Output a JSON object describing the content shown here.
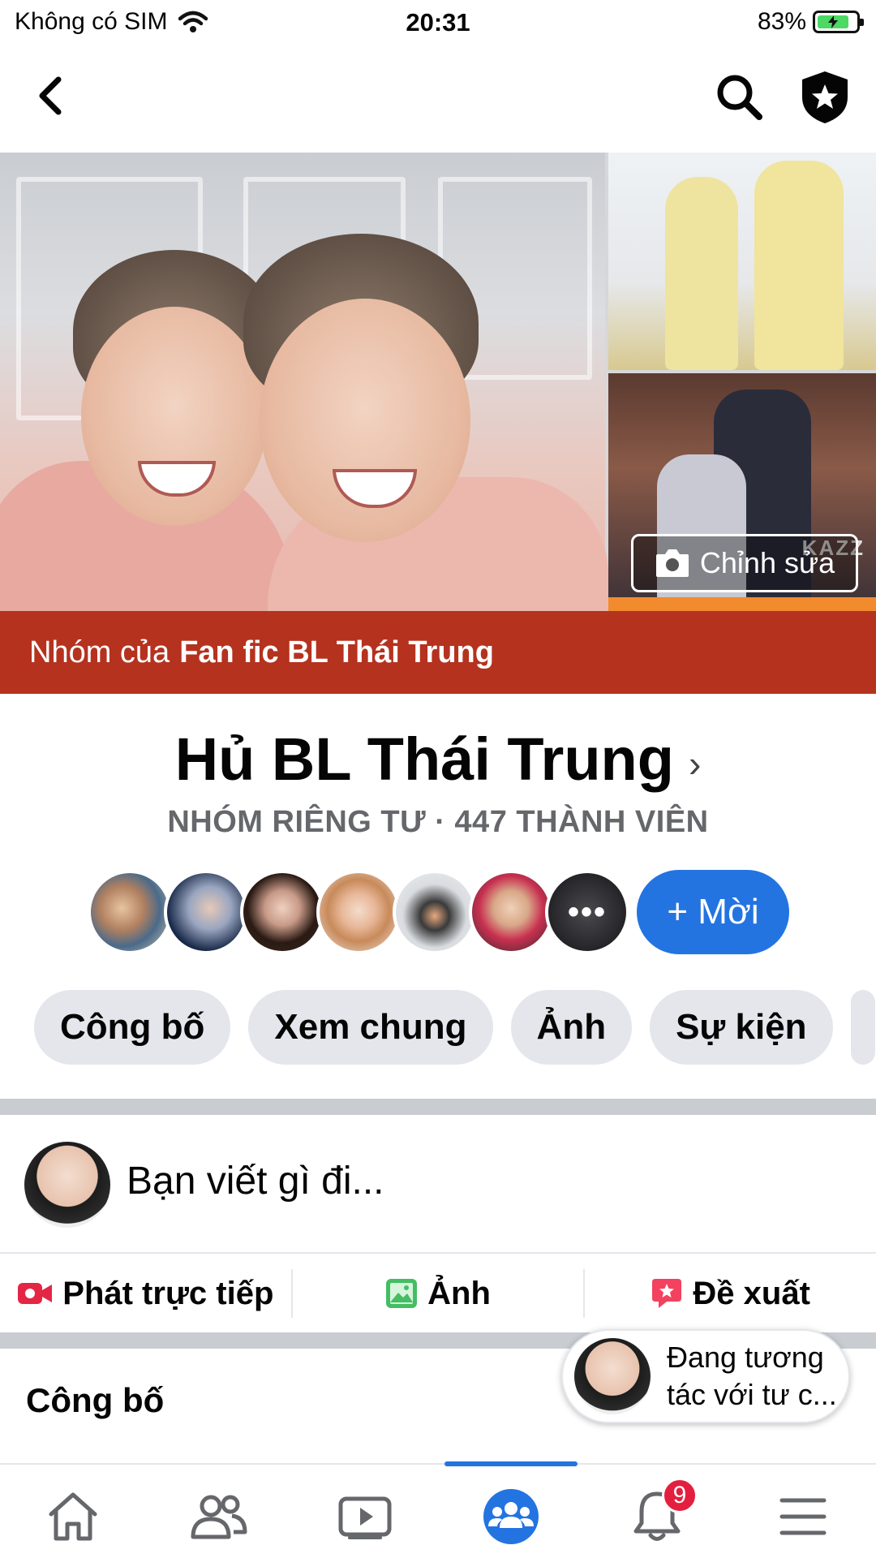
{
  "status_bar": {
    "carrier": "Không có SIM",
    "time": "20:31",
    "battery": "83%",
    "battery_level": 0.83
  },
  "nav": {
    "back_icon": "chevron-left-icon",
    "search_icon": "search-icon",
    "shield_icon": "admin-shield-icon"
  },
  "cover": {
    "edit_label": "Chỉnh sửa",
    "watermark": "KAZZ"
  },
  "banner": {
    "prefix": "Nhóm của",
    "owner": "Fan fic BL Thái Trung"
  },
  "group": {
    "name": "Hủ BL Thái Trung",
    "meta": "NHÓM RIÊNG TƯ · 447 THÀNH VIÊN"
  },
  "members": {
    "more": "•••",
    "invite_label": "+ Mời"
  },
  "chips": [
    "Công bố",
    "Xem chung",
    "Ảnh",
    "Sự kiện"
  ],
  "composer": {
    "placeholder": "Bạn viết gì đi..."
  },
  "actions": [
    "Phát trực tiếp",
    "Ảnh",
    "Đề xuất"
  ],
  "section": {
    "title": "Công bố"
  },
  "bubble": {
    "text": "Đang tương tác với tư c..."
  },
  "tabs": {
    "notification_badge": "9"
  },
  "colors": {
    "accent": "#2374e1",
    "banner": "#b5321f",
    "badge": "#e41e3f"
  }
}
